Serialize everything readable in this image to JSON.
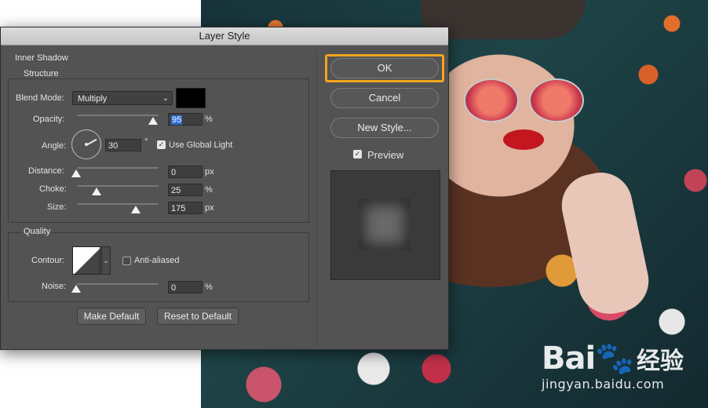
{
  "dialog": {
    "title": "Layer Style",
    "section_title": "Inner Shadow",
    "structure": {
      "title": "Structure",
      "blend_mode_label": "Blend Mode:",
      "blend_mode_value": "Multiply",
      "blend_color": "#000000",
      "opacity_label": "Opacity:",
      "opacity_value": "95",
      "opacity_unit": "%",
      "angle_label": "Angle:",
      "angle_value": "30",
      "angle_unit": "°",
      "use_global_light_label": "Use Global Light",
      "use_global_light_checked": true,
      "distance_label": "Distance:",
      "distance_value": "0",
      "distance_unit": "px",
      "choke_label": "Choke:",
      "choke_value": "25",
      "choke_unit": "%",
      "size_label": "Size:",
      "size_value": "175",
      "size_unit": "px"
    },
    "quality": {
      "title": "Quality",
      "contour_label": "Contour:",
      "anti_aliased_label": "Anti-aliased",
      "anti_aliased_checked": false,
      "noise_label": "Noise:",
      "noise_value": "0",
      "noise_unit": "%"
    },
    "make_default_label": "Make Default",
    "reset_default_label": "Reset to Default",
    "ok_label": "OK",
    "cancel_label": "Cancel",
    "new_style_label": "New Style...",
    "preview_label": "Preview",
    "preview_checked": true,
    "highlight_color": "#f4a51c"
  },
  "watermark": {
    "logo": "Bai",
    "logo_cn": "经验",
    "url": "jingyan.baidu.com"
  }
}
